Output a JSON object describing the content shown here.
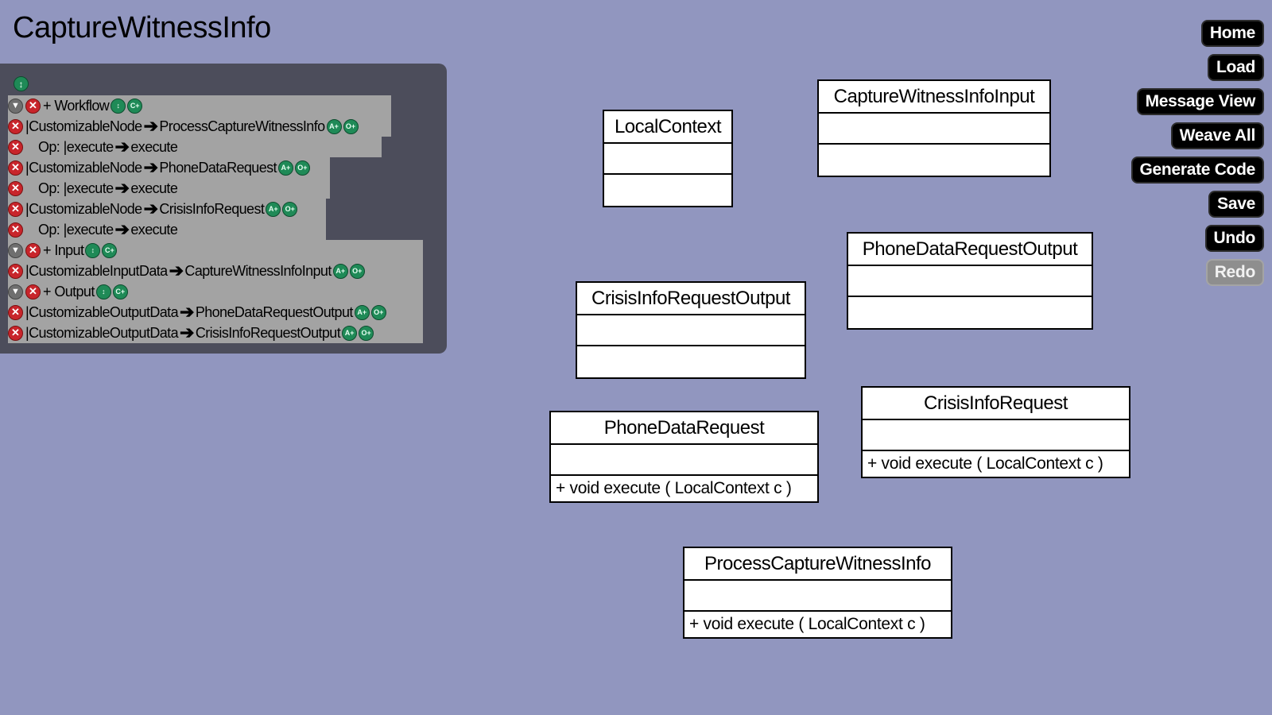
{
  "page": {
    "title": "CaptureWitnessInfo"
  },
  "tree": {
    "rows": [
      {
        "kind": "group",
        "label": "+ Workflow",
        "badges": [
          "↕",
          "C+"
        ]
      },
      {
        "kind": "node",
        "source": "|CustomizableNode",
        "target": "ProcessCaptureWitnessInfo",
        "badges": [
          "A+",
          "O+"
        ]
      },
      {
        "kind": "op",
        "source": "Op: |execute",
        "target": "execute"
      },
      {
        "kind": "node",
        "source": "|CustomizableNode",
        "target": "PhoneDataRequest",
        "badges": [
          "A+",
          "O+"
        ]
      },
      {
        "kind": "op",
        "source": "Op: |execute",
        "target": "execute"
      },
      {
        "kind": "node",
        "source": "|CustomizableNode",
        "target": "CrisisInfoRequest",
        "badges": [
          "A+",
          "O+"
        ]
      },
      {
        "kind": "op",
        "source": "Op: |execute",
        "target": "execute"
      },
      {
        "kind": "group",
        "label": "+ Input",
        "badges": [
          "↕",
          "C+"
        ]
      },
      {
        "kind": "node",
        "source": "|CustomizableInputData",
        "target": "CaptureWitnessInfoInput",
        "badges": [
          "A+",
          "O+"
        ]
      },
      {
        "kind": "group",
        "label": "+ Output",
        "badges": [
          "↕",
          "C+"
        ]
      },
      {
        "kind": "node",
        "source": "|CustomizableOutputData",
        "target": "PhoneDataRequestOutput",
        "badges": [
          "A+",
          "O+"
        ]
      },
      {
        "kind": "node",
        "source": "|CustomizableOutputData",
        "target": "CrisisInfoRequestOutput",
        "badges": [
          "A+",
          "O+"
        ]
      }
    ]
  },
  "buttons": {
    "home": "Home",
    "load": "Load",
    "message_view": "Message View",
    "weave_all": "Weave All",
    "generate_code": "Generate Code",
    "save": "Save",
    "undo": "Undo",
    "redo": "Redo"
  },
  "diagram": {
    "local_context": {
      "name": "LocalContext",
      "operation": ""
    },
    "capture_witness_info_input": {
      "name": "CaptureWitnessInfoInput",
      "operation": ""
    },
    "phone_data_request_output": {
      "name": "PhoneDataRequestOutput",
      "operation": ""
    },
    "crisis_info_request_output": {
      "name": "CrisisInfoRequestOutput",
      "operation": ""
    },
    "crisis_info_request": {
      "name": "CrisisInfoRequest",
      "operation": "+ void  execute ( LocalContext  c )"
    },
    "phone_data_request": {
      "name": "PhoneDataRequest",
      "operation": "+ void  execute ( LocalContext  c )"
    },
    "process_capture_witness_info": {
      "name": "ProcessCaptureWitnessInfo",
      "operation": "+ void  execute ( LocalContext  c )"
    }
  },
  "colors": {
    "background": "#9196bf",
    "panel": "#4c4d5b",
    "row": "#a3a3a3",
    "button": "#000000",
    "button_disabled": "#8e8e8e",
    "badge_green": "#1f8a57",
    "badge_red": "#c8252b"
  }
}
